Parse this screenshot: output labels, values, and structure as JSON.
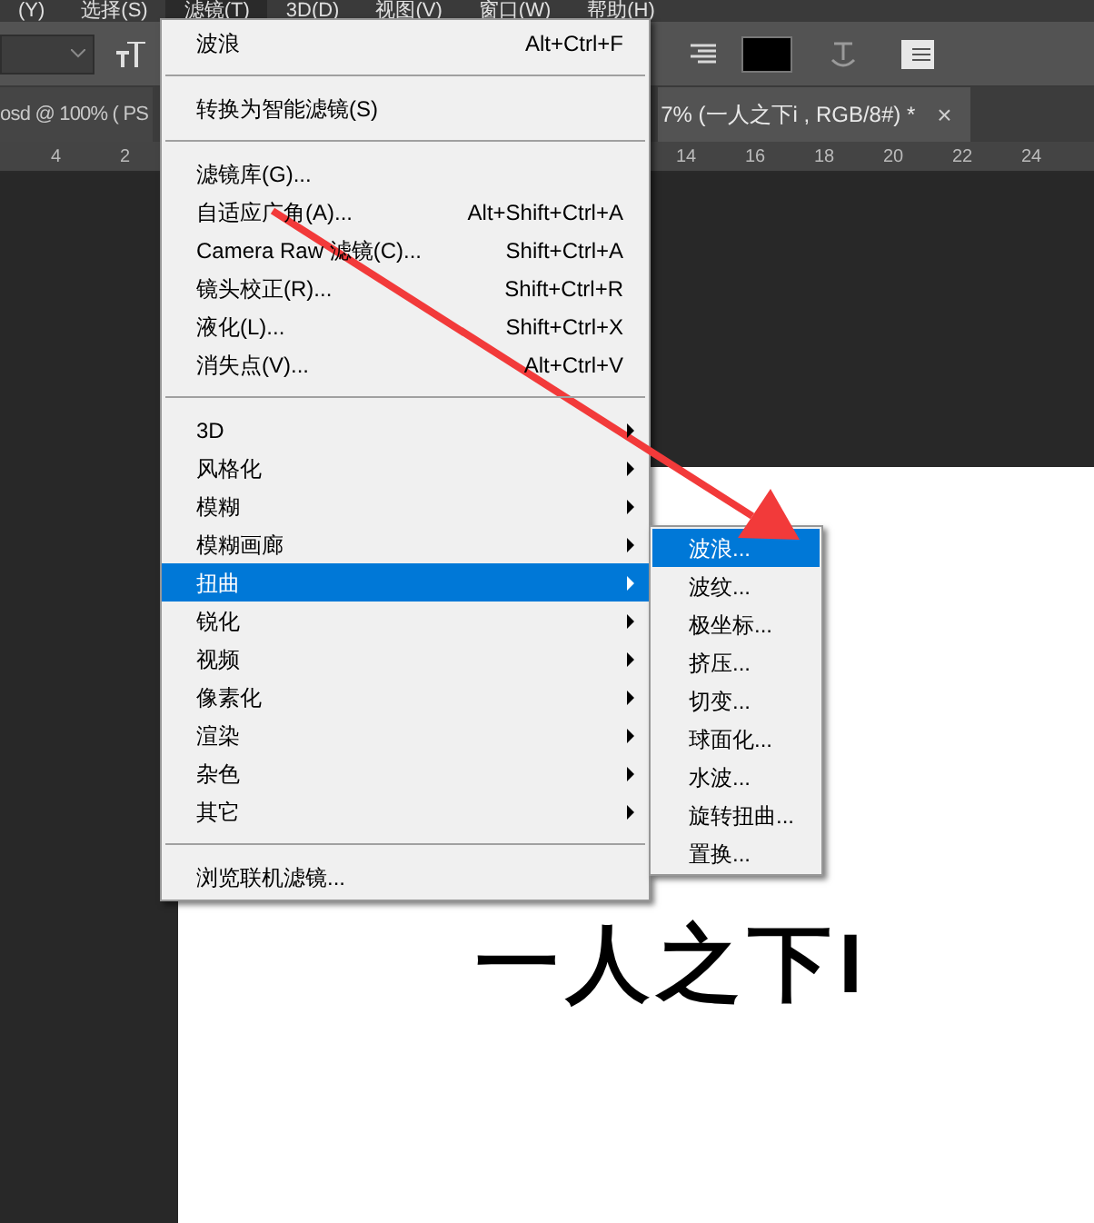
{
  "menu_bar": [
    {
      "label": "(Y)",
      "selected": false
    },
    {
      "label": "选择(S)",
      "selected": false
    },
    {
      "label": "滤镜(T)",
      "selected": true
    },
    {
      "label": "3D(D)",
      "selected": false
    },
    {
      "label": "视图(V)",
      "selected": false
    },
    {
      "label": "窗口(W)",
      "selected": false
    },
    {
      "label": "帮助(H)",
      "selected": false
    }
  ],
  "document_tabs": [
    {
      "label": "osd @ 100% ( PS",
      "selected": false
    },
    {
      "label": "7% (一人之下i , RGB/8#) *",
      "close": "×",
      "selected": true
    }
  ],
  "ruler": {
    "left_labels": [
      "4",
      "2"
    ],
    "right_labels": [
      "14",
      "16",
      "18",
      "20",
      "22",
      "24"
    ]
  },
  "filter_menu": [
    {
      "kind": "item",
      "label": "波浪",
      "shortcut": "Alt+Ctrl+F",
      "selected": false
    },
    {
      "kind": "separator"
    },
    {
      "kind": "item",
      "label": "转换为智能滤镜(S)",
      "selected": false
    },
    {
      "kind": "separator"
    },
    {
      "kind": "item",
      "label": "滤镜库(G)...",
      "selected": false
    },
    {
      "kind": "item",
      "label": "自适应广角(A)...",
      "shortcut": "Alt+Shift+Ctrl+A",
      "selected": false
    },
    {
      "kind": "item",
      "label": "Camera Raw 滤镜(C)...",
      "shortcut": "Shift+Ctrl+A",
      "selected": false
    },
    {
      "kind": "item",
      "label": "镜头校正(R)...",
      "shortcut": "Shift+Ctrl+R",
      "selected": false
    },
    {
      "kind": "item",
      "label": "液化(L)...",
      "shortcut": "Shift+Ctrl+X",
      "selected": false
    },
    {
      "kind": "item",
      "label": "消失点(V)...",
      "shortcut": "Alt+Ctrl+V",
      "selected": false
    },
    {
      "kind": "separator"
    },
    {
      "kind": "submenu",
      "label": "3D",
      "selected": false
    },
    {
      "kind": "submenu",
      "label": "风格化",
      "selected": false
    },
    {
      "kind": "submenu",
      "label": "模糊",
      "selected": false
    },
    {
      "kind": "submenu",
      "label": "模糊画廊",
      "selected": false
    },
    {
      "kind": "submenu",
      "label": "扭曲",
      "selected": true
    },
    {
      "kind": "submenu",
      "label": "锐化",
      "selected": false
    },
    {
      "kind": "submenu",
      "label": "视频",
      "selected": false
    },
    {
      "kind": "submenu",
      "label": "像素化",
      "selected": false
    },
    {
      "kind": "submenu",
      "label": "渲染",
      "selected": false
    },
    {
      "kind": "submenu",
      "label": "杂色",
      "selected": false
    },
    {
      "kind": "submenu",
      "label": "其它",
      "selected": false
    },
    {
      "kind": "separator"
    },
    {
      "kind": "item",
      "label": "浏览联机滤镜...",
      "selected": false
    }
  ],
  "distort_submenu": [
    {
      "label": "波浪...",
      "selected": true
    },
    {
      "label": "波纹...",
      "selected": false
    },
    {
      "label": "极坐标...",
      "selected": false
    },
    {
      "label": "挤压...",
      "selected": false
    },
    {
      "label": "切变...",
      "selected": false
    },
    {
      "label": "球面化...",
      "selected": false
    },
    {
      "label": "水波...",
      "selected": false
    },
    {
      "label": "旋转扭曲...",
      "selected": false
    },
    {
      "label": "置换...",
      "selected": false
    }
  ],
  "canvas": {
    "text": "一人之下I"
  }
}
